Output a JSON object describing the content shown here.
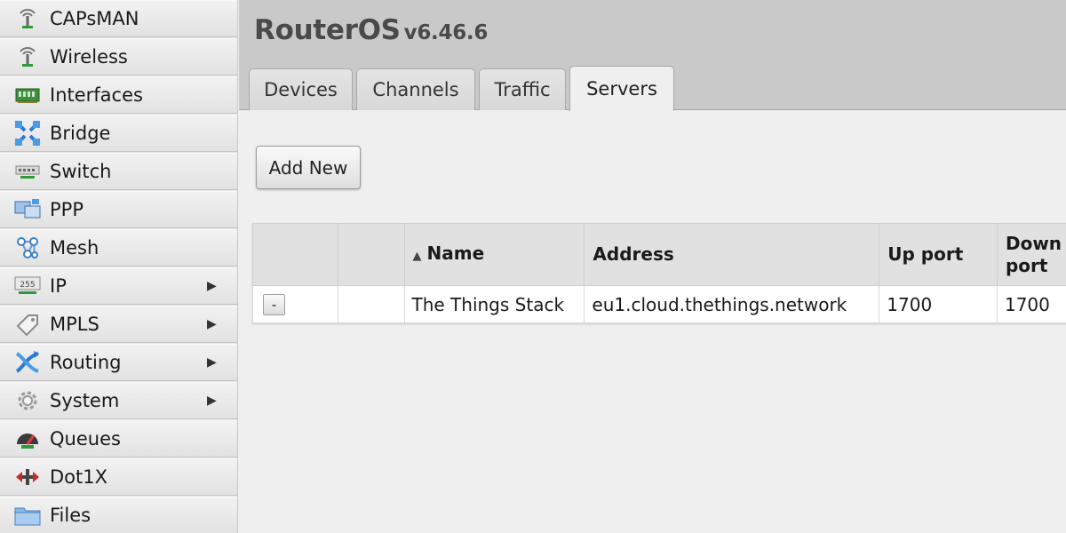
{
  "sidebar": {
    "items": [
      {
        "label": "CAPsMAN",
        "icon": "antenna-icon",
        "submenu": false
      },
      {
        "label": "Wireless",
        "icon": "antenna-icon",
        "submenu": false
      },
      {
        "label": "Interfaces",
        "icon": "network-card-icon",
        "submenu": false
      },
      {
        "label": "Bridge",
        "icon": "bridge-icon",
        "submenu": false
      },
      {
        "label": "Switch",
        "icon": "switch-icon",
        "submenu": false
      },
      {
        "label": "PPP",
        "icon": "ppp-icon",
        "submenu": false
      },
      {
        "label": "Mesh",
        "icon": "mesh-icon",
        "submenu": false
      },
      {
        "label": "IP",
        "icon": "ip-icon",
        "submenu": true
      },
      {
        "label": "MPLS",
        "icon": "mpls-tag-icon",
        "submenu": true
      },
      {
        "label": "Routing",
        "icon": "routing-icon",
        "submenu": true
      },
      {
        "label": "System",
        "icon": "gear-icon",
        "submenu": true
      },
      {
        "label": "Queues",
        "icon": "gauge-icon",
        "submenu": false
      },
      {
        "label": "Dot1X",
        "icon": "dot1x-icon",
        "submenu": false
      },
      {
        "label": "Files",
        "icon": "folder-icon",
        "submenu": false
      }
    ],
    "submenu_arrow": "▶"
  },
  "header": {
    "app_name": "RouterOS",
    "version": "v6.46.6",
    "tabs": [
      {
        "label": "Devices",
        "active": false
      },
      {
        "label": "Channels",
        "active": false
      },
      {
        "label": "Traffic",
        "active": false
      },
      {
        "label": "Servers",
        "active": true
      }
    ]
  },
  "toolbar": {
    "add_new_label": "Add New"
  },
  "table": {
    "columns": [
      "",
      "",
      "Name",
      "Address",
      "Up port",
      "Down port"
    ],
    "sorted_column": "Name",
    "sort_indicator": "▲",
    "rows": [
      {
        "remove_label": "-",
        "name": "The Things Stack",
        "address": "eu1.cloud.thethings.network",
        "up_port": "1700",
        "down_port": "1700"
      }
    ]
  }
}
